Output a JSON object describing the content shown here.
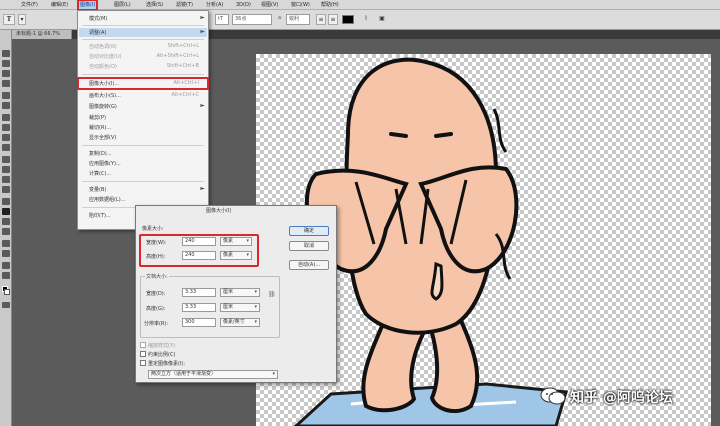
{
  "menubar": {
    "items": [
      "文件(F)",
      "编辑(E)",
      "图像(I)",
      "图层(L)",
      "选择(S)",
      "滤镜(T)",
      "分析(A)",
      "3D(D)",
      "视图(V)",
      "窗口(W)",
      "帮助(H)"
    ]
  },
  "doc_tab": "未标题-1 @ 66.7%",
  "image_menu": {
    "items": [
      {
        "label": "模式(M)",
        "shortcut": "",
        "arrow": "►"
      },
      {
        "label": "调整(A)",
        "shortcut": "",
        "arrow": "►"
      },
      {
        "label": "自动色调(N)",
        "shortcut": "Shift+Ctrl+L",
        "arrow": ""
      },
      {
        "label": "自动对比度(U)",
        "shortcut": "Alt+Shift+Ctrl+L",
        "arrow": ""
      },
      {
        "label": "自动颜色(O)",
        "shortcut": "Shift+Ctrl+B",
        "arrow": ""
      },
      {
        "label": "图像大小(I)...",
        "shortcut": "Alt+Ctrl+I",
        "arrow": ""
      },
      {
        "label": "画布大小(S)...",
        "shortcut": "Alt+Ctrl+C",
        "arrow": ""
      },
      {
        "label": "图像旋转(G)",
        "shortcut": "",
        "arrow": "►"
      },
      {
        "label": "裁剪(P)",
        "shortcut": "",
        "arrow": ""
      },
      {
        "label": "裁切(R)...",
        "shortcut": "",
        "arrow": ""
      },
      {
        "label": "显示全部(V)",
        "shortcut": "",
        "arrow": ""
      },
      {
        "label": "复制(D)...",
        "shortcut": "",
        "arrow": ""
      },
      {
        "label": "应用图像(Y)...",
        "shortcut": "",
        "arrow": ""
      },
      {
        "label": "计算(C)...",
        "shortcut": "",
        "arrow": ""
      },
      {
        "label": "变量(B)",
        "shortcut": "",
        "arrow": "►"
      },
      {
        "label": "应用数据组(L)...",
        "shortcut": "",
        "arrow": ""
      },
      {
        "label": "陷印(T)...",
        "shortcut": "",
        "arrow": ""
      }
    ]
  },
  "dialog": {
    "title": "图像大小(I)",
    "buttons": {
      "ok": "确定",
      "cancel": "取消",
      "auto": "自动(A)..."
    },
    "pixel_dims": {
      "label": "像素大小:",
      "width_label": "宽度(W):",
      "width_value": "240",
      "width_unit": "像素",
      "height_label": "高度(H):",
      "height_value": "240",
      "height_unit": "像素"
    },
    "doc_size": {
      "label": "文档大小:",
      "width_label": "宽度(D):",
      "width_value": "3.33",
      "width_unit": "厘米",
      "height_label": "高度(G):",
      "height_value": "3.33",
      "height_unit": "厘米",
      "res_label": "分辨率(R):",
      "res_value": "300",
      "res_unit": "像素/英寸"
    },
    "options": {
      "scale_styles": "缩放样式(Y)",
      "constrain": "约束比例(C)",
      "resample": "重定图像像素(I):",
      "method": "两次立方（适用于平滑渐变）"
    }
  },
  "options_bar": {
    "font_size": "36点",
    "aa_value": "锐利"
  },
  "watermark": {
    "text": "知乎 @阿呜论坛"
  }
}
